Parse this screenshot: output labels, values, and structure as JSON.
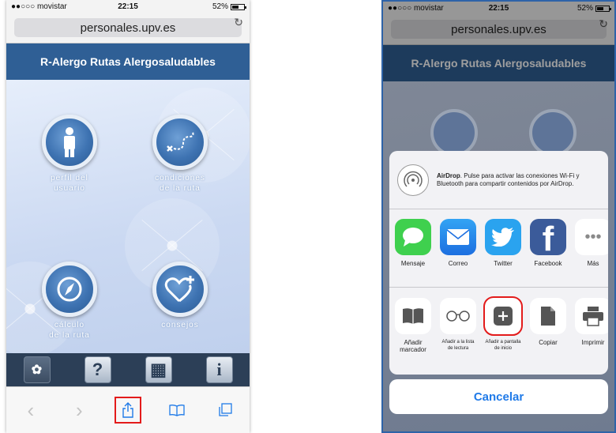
{
  "colors": {
    "accent": "#1f7ae8",
    "banner": "#2f5f95",
    "highlight": "#e31b1b"
  },
  "status": {
    "carrier": "●●○○○ movistar",
    "time": "22:15",
    "battery": "52%",
    "battery_level": 0.52
  },
  "browser": {
    "url": "personales.upv.es",
    "reload_icon": "reload-icon"
  },
  "app": {
    "title": "R-Alergo Rutas Alergosaludables",
    "menu": [
      {
        "label": "perfil del\nusuario",
        "icon": "person-icon"
      },
      {
        "label": "condiciones\nde la ruta",
        "icon": "route-icon"
      },
      {
        "label": "cálculo\nde la ruta",
        "icon": "compass-icon"
      },
      {
        "label": "consejos",
        "icon": "heart-plus-icon"
      }
    ],
    "tabbar": [
      {
        "icon": "dandelion-icon",
        "glyph": "✿"
      },
      {
        "icon": "help-icon",
        "glyph": "?"
      },
      {
        "icon": "map-icon",
        "glyph": "▦"
      },
      {
        "icon": "info-icon",
        "glyph": "i"
      }
    ]
  },
  "toolbar": [
    {
      "icon": "back-icon",
      "glyph": "‹"
    },
    {
      "icon": "forward-icon",
      "glyph": "›"
    },
    {
      "icon": "share-icon",
      "glyph": "⇧"
    },
    {
      "icon": "bookmarks-icon",
      "glyph": "📖"
    },
    {
      "icon": "tabs-icon",
      "glyph": "❐"
    }
  ],
  "share_sheet": {
    "airdrop_title": "AirDrop",
    "airdrop_text": ". Pulse para activar las conexiones Wi-Fi y Bluetooth para compartir contenidos por AirDrop.",
    "apps": [
      {
        "label": "Mensaje",
        "icon": "messages-icon"
      },
      {
        "label": "Correo",
        "icon": "mail-icon"
      },
      {
        "label": "Twitter",
        "icon": "twitter-icon"
      },
      {
        "label": "Facebook",
        "icon": "facebook-icon"
      },
      {
        "label": "Más",
        "icon": "more-icon"
      }
    ],
    "actions": [
      {
        "label": "Añadir marcador",
        "icon": "bookmark-icon"
      },
      {
        "label": "Añadir a la lista de lectura",
        "icon": "reading-list-icon"
      },
      {
        "label": "Añadir a pantalla de inicio",
        "icon": "add-home-icon"
      },
      {
        "label": "Copiar",
        "icon": "copy-icon"
      },
      {
        "label": "Imprimir",
        "icon": "print-icon"
      }
    ],
    "cancel": "Cancelar"
  }
}
